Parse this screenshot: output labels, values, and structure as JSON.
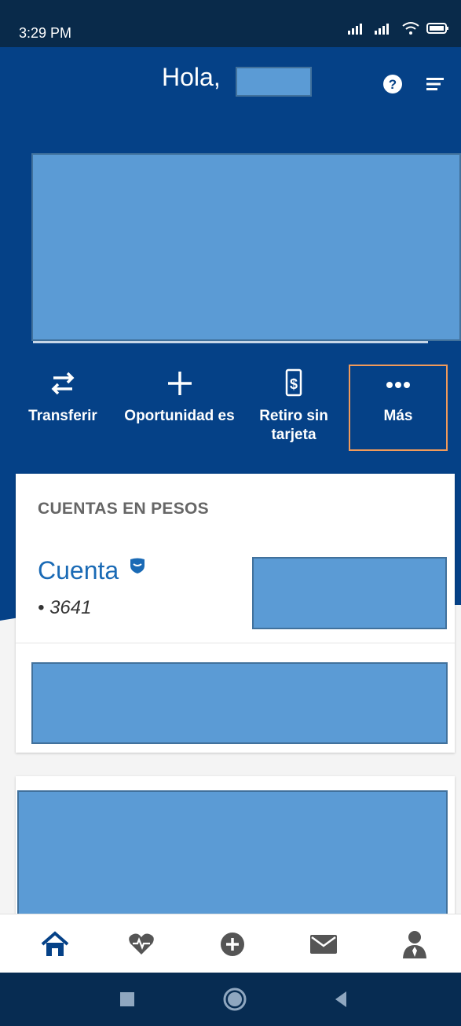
{
  "status_bar": {
    "time": "3:29 PM",
    "icons": [
      "signal-icon",
      "signal-icon",
      "wifi-icon",
      "battery-icon"
    ]
  },
  "header": {
    "greeting": "Hola,",
    "icons": [
      "help-icon",
      "menu-icon"
    ]
  },
  "quick_actions": [
    {
      "label": "Transferir",
      "icon": "transfer-arrows-icon"
    },
    {
      "label": "Oportunidad es",
      "icon": "plus-icon"
    },
    {
      "label": "Retiro sin tarjeta",
      "icon": "phone-dollar-icon"
    },
    {
      "label": "Más",
      "icon": "more-dots-icon"
    }
  ],
  "accounts": {
    "section_title": "CUENTAS EN PESOS",
    "account_name": "Cuenta",
    "account_number": "• 3641"
  },
  "bottom_nav": [
    "home-icon",
    "health-icon",
    "add-icon",
    "mail-icon",
    "profile-icon"
  ],
  "system_nav": [
    "recents-icon",
    "home-circle-icon",
    "back-icon"
  ],
  "colors": {
    "primary": "#054187",
    "status_bar": "#092a4a",
    "accent_text": "#1a6ab5",
    "highlight_frame": "#f19a5a"
  }
}
